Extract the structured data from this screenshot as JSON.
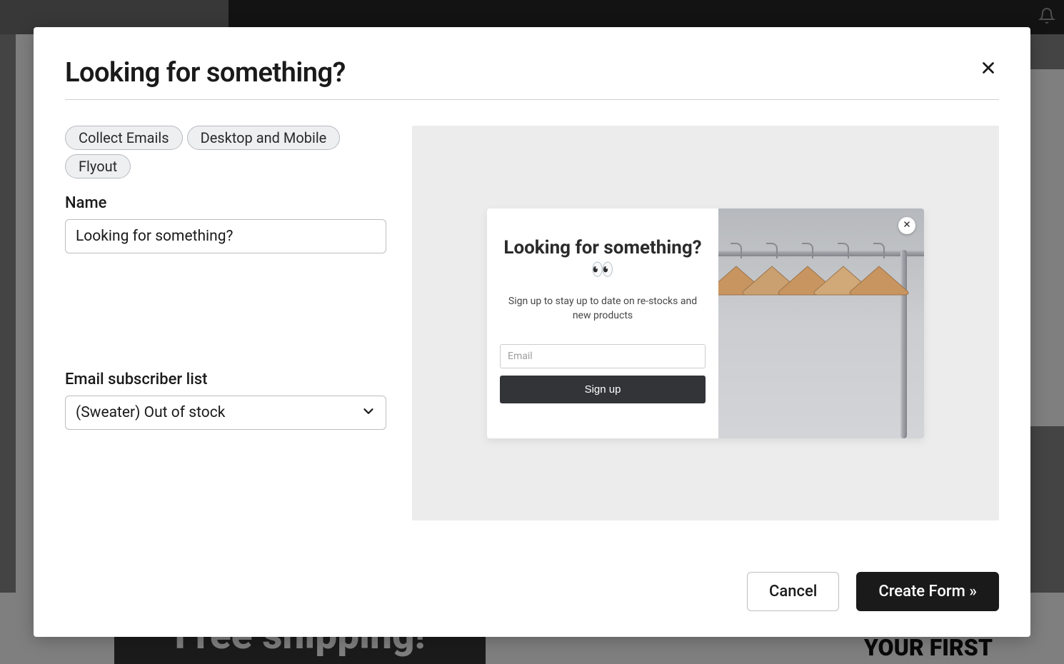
{
  "modal": {
    "title": "Looking for something?",
    "chips": [
      "Collect Emails",
      "Desktop and Mobile",
      "Flyout"
    ],
    "name_label": "Name",
    "name_value": "Looking for something?",
    "list_label": "Email subscriber list",
    "list_value": "(Sweater) Out of stock",
    "cancel_label": "Cancel",
    "create_label": "Create Form »"
  },
  "preview": {
    "title": "Looking for something? 👀",
    "subtitle": "Sign up to stay up to date on re-stocks and new products",
    "email_placeholder": "Email",
    "signup_label": "Sign up"
  },
  "background": {
    "banner": "Free shipping!",
    "corner": "YOUR FIRST"
  }
}
